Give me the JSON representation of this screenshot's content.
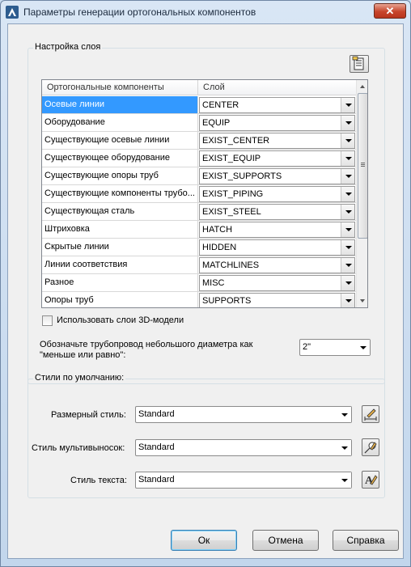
{
  "window": {
    "title": "Параметры генерации ортогональных компонентов",
    "close_label": "✕"
  },
  "layer_group": {
    "legend": "Настройка слоя",
    "columns": [
      "Ортогональные компоненты",
      "Слой"
    ],
    "rows": [
      {
        "name": "Осевые линии",
        "layer": "CENTER",
        "selected": true
      },
      {
        "name": "Оборудование",
        "layer": "EQUIP"
      },
      {
        "name": "Существующие осевые линии",
        "layer": "EXIST_CENTER"
      },
      {
        "name": "Существующее оборудование",
        "layer": "EXIST_EQUIP"
      },
      {
        "name": "Существующие опоры труб",
        "layer": "EXIST_SUPPORTS"
      },
      {
        "name": "Существующие компоненты трубо...",
        "layer": "EXIST_PIPING"
      },
      {
        "name": "Существующая сталь",
        "layer": "EXIST_STEEL"
      },
      {
        "name": "Штриховка",
        "layer": "HATCH"
      },
      {
        "name": "Скрытые линии",
        "layer": "HIDDEN"
      },
      {
        "name": "Линии соответствия",
        "layer": "MATCHLINES"
      },
      {
        "name": "Разное",
        "layer": "MISC"
      },
      {
        "name": "Опоры труб",
        "layer": "SUPPORTS"
      }
    ],
    "use_3d_layers_label": "Использовать слои 3D-модели",
    "use_3d_layers_checked": false,
    "small_pipe_label_line1": "Обозначьте трубопровод небольшого диаметра как",
    "small_pipe_label_line2": "\"меньше или равно\":",
    "small_pipe_value": "2\""
  },
  "styles_group": {
    "legend": "Стили по умолчанию:",
    "dim_style_label": "Размерный стиль:",
    "dim_style_value": "Standard",
    "mleader_style_label": "Стиль мультивыносок:",
    "mleader_style_value": "Standard",
    "text_style_label": "Стиль текста:",
    "text_style_value": "Standard"
  },
  "buttons": {
    "ok": "Ок",
    "cancel": "Отмена",
    "help": "Справка"
  },
  "colors": {
    "selection": "#3399ff",
    "close": "#c7452b"
  }
}
